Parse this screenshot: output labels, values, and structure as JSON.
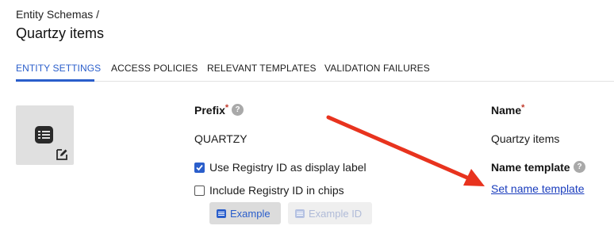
{
  "breadcrumb": "Entity Schemas /",
  "page_title": "Quartzy items",
  "tabs": [
    {
      "label": "ENTITY SETTINGS",
      "active": true
    },
    {
      "label": "ACCESS POLICIES",
      "active": false
    },
    {
      "label": "RELEVANT TEMPLATES",
      "active": false
    },
    {
      "label": "VALIDATION FAILURES",
      "active": false
    }
  ],
  "icons": {
    "entity": "list-icon",
    "edit": "edit-icon",
    "help": "help-icon",
    "button": "list-icon",
    "annotation": "red-arrow"
  },
  "prefix": {
    "label": "Prefix",
    "required_mark": "*",
    "help_glyph": "?",
    "value": "QUARTZY"
  },
  "options": {
    "use_registry_id": {
      "label": "Use Registry ID as display label",
      "checked": true
    },
    "include_registry_id": {
      "label": "Include Registry ID in chips",
      "checked": false
    }
  },
  "buttons": {
    "example": "Example",
    "example_id": "Example ID"
  },
  "name": {
    "label": "Name",
    "required_mark": "*",
    "value": "Quartzy items"
  },
  "name_template": {
    "label": "Name template",
    "help_glyph": "?",
    "link": "Set name template"
  },
  "colors": {
    "accent": "#2a5ecb",
    "link": "#1a3dbd",
    "required": "#c0392b",
    "annotation_arrow": "#e8331e"
  }
}
